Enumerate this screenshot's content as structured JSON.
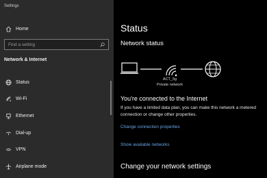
{
  "app": {
    "title": "Settings"
  },
  "sidebar": {
    "home_label": "Home",
    "search_placeholder": "Find a setting",
    "section_label": "Network & Internet",
    "items": [
      {
        "label": "Status",
        "icon": "globe-icon"
      },
      {
        "label": "Wi-Fi",
        "icon": "wifi-icon"
      },
      {
        "label": "Ethernet",
        "icon": "ethernet-icon"
      },
      {
        "label": "Dial-up",
        "icon": "phone-icon"
      },
      {
        "label": "VPN",
        "icon": "vpn-icon"
      },
      {
        "label": "Airplane mode",
        "icon": "airplane-icon"
      }
    ]
  },
  "main": {
    "title": "Status",
    "subtitle": "Network status",
    "network": {
      "name": "ACT_5g",
      "type": "Private network"
    },
    "connected_title": "You're connected to the Internet",
    "connected_desc": "If you have a limited data plan, you can make this network a metered connection or change other properties.",
    "link_change_props": "Change connection properties",
    "link_show_networks": "Show available networks",
    "section_change": "Change your network settings"
  },
  "colors": {
    "sidebar_bg": "#2b2b2b",
    "main_bg": "#000000",
    "link": "#6aa5e8"
  }
}
